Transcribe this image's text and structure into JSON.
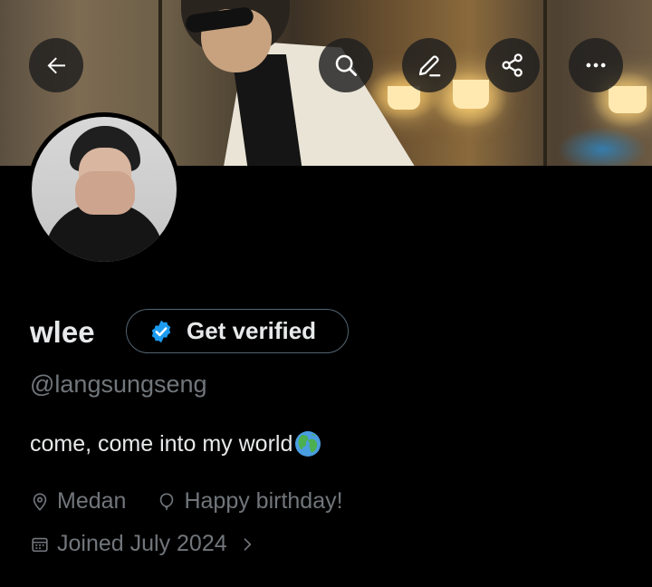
{
  "banner": {
    "description_icon": "header-photo"
  },
  "toolbar": {
    "back_icon": "arrow-left-icon",
    "search_icon": "search-icon",
    "edit_icon": "pencil-icon",
    "share_icon": "share-icon",
    "more_icon": "more-horizontal-icon"
  },
  "profile": {
    "display_name": "wlee",
    "verify_button_label": "Get verified",
    "handle": "@langsungseng",
    "bio": "come, come into my world",
    "bio_emoji": "globe-icon",
    "location": "Medan",
    "birthday": "Happy birthday!",
    "joined": "Joined July 2024"
  },
  "colors": {
    "background": "#000000",
    "primary_text": "#e7e9ea",
    "secondary_text": "#71767b",
    "verified_blue": "#1d9bf0",
    "button_border": "#536471"
  }
}
